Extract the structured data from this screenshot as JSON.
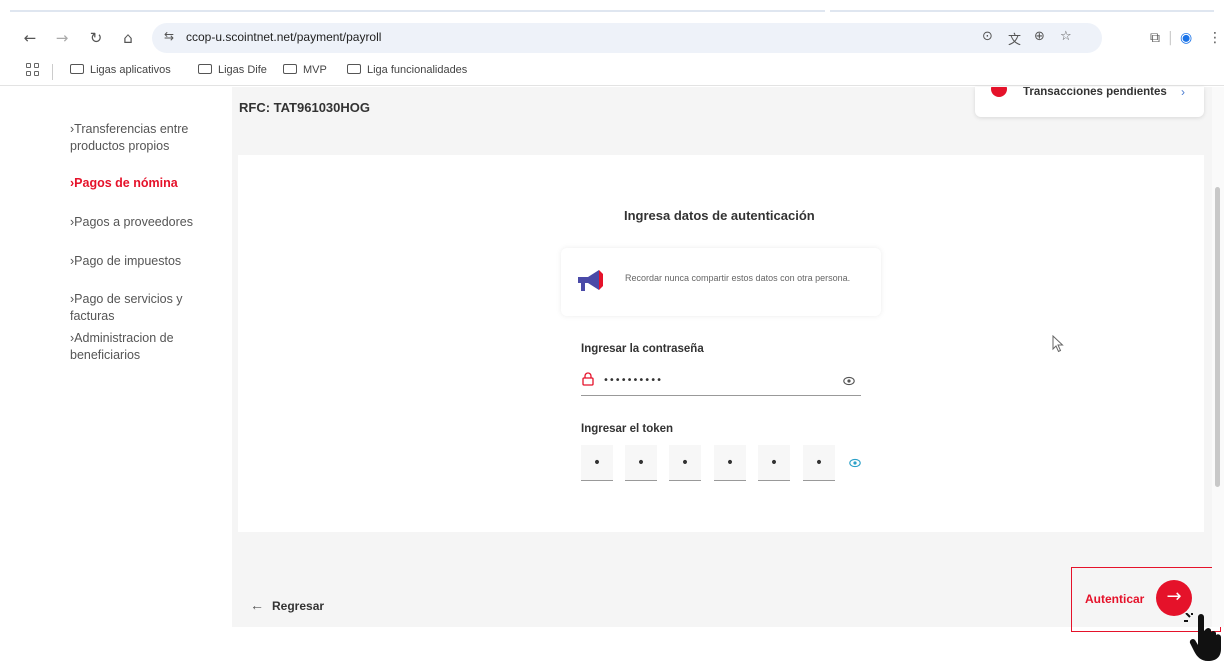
{
  "browser": {
    "url": "ccop-u.scointnet.net/payment/payroll",
    "bookmarks": [
      "Ligas aplicativos",
      "Ligas Dife",
      "MVP",
      "Liga funcionalidades"
    ]
  },
  "header": {
    "rfc": "RFC: TAT961030HOG",
    "pending_label": "Transacciones pendientes"
  },
  "sidebar": {
    "items": [
      {
        "label": "Transferencias entre productos propios",
        "active": false
      },
      {
        "label": "Pagos de nómina",
        "active": true
      },
      {
        "label": "Pagos a proveedores",
        "active": false
      },
      {
        "label": "Pago de impuestos",
        "active": false
      },
      {
        "label": "Pago de servicios y facturas",
        "active": false
      },
      {
        "label": "Administracion de beneficiarios",
        "active": false
      }
    ]
  },
  "auth": {
    "title": "Ingresa datos de autenticación",
    "notice": "Recordar nunca compartir estos datos con otra persona.",
    "password_label": "Ingresar la contraseña",
    "password_value": "••••••••••",
    "token_label": "Ingresar el token",
    "token_digits": [
      "•",
      "•",
      "•",
      "•",
      "•",
      "•"
    ]
  },
  "footer": {
    "back_label": "Regresar",
    "authenticate_label": "Autenticar"
  },
  "colors": {
    "accent": "#e5122a",
    "link": "#4a7bd0"
  }
}
